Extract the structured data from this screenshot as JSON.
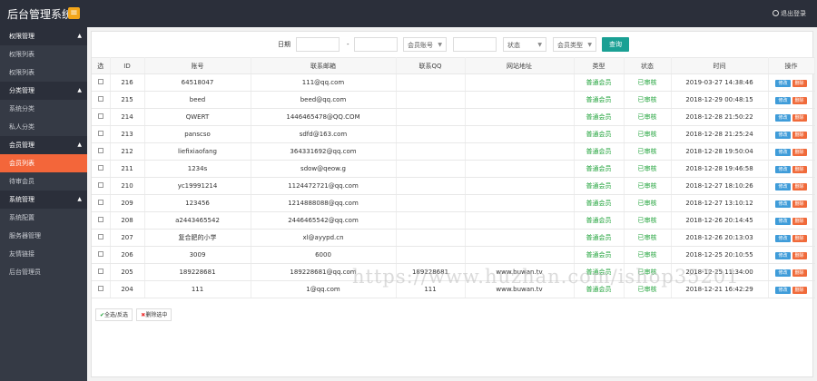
{
  "header": {
    "title": "后台管理系统",
    "menu_icon": "menu-icon",
    "logout": "退出登录"
  },
  "sidebar": {
    "groups": [
      {
        "label": "权限管理",
        "items": [
          "权限列表",
          "权限列表"
        ]
      },
      {
        "label": "分类管理",
        "items": [
          "系统分类",
          "私人分类"
        ]
      },
      {
        "label": "会员管理",
        "items": [
          "会员列表",
          "待审会员"
        ]
      },
      {
        "label": "系统管理",
        "items": [
          "系统配置",
          "服务器管理",
          "友情链接",
          "后台管理员"
        ]
      }
    ],
    "active": "会员列表"
  },
  "filter": {
    "date_label": "日期",
    "dash": "-",
    "account_select": "会员账号",
    "status_select": "状态",
    "type_select": "会员类型",
    "search_button": "查询"
  },
  "table": {
    "headers": [
      "选",
      "ID",
      "账号",
      "联系邮箱",
      "联系QQ",
      "网站地址",
      "类型",
      "状态",
      "时间",
      "操作"
    ],
    "rows": [
      [
        "216",
        "64518047",
        "111@qq.com",
        "",
        "",
        "普通会员",
        "已审核",
        "2019-03-27 14:38:46"
      ],
      [
        "215",
        "beed",
        "beed@qq.com",
        "",
        "",
        "普通会员",
        "已审核",
        "2018-12-29 00:48:15"
      ],
      [
        "214",
        "QWERT",
        "1446465478@QQ.COM",
        "",
        "",
        "普通会员",
        "已审核",
        "2018-12-28 21:50:22"
      ],
      [
        "213",
        "panscso",
        "sdfd@163.com",
        "",
        "",
        "普通会员",
        "已审核",
        "2018-12-28 21:25:24"
      ],
      [
        "212",
        "liefixiaofang",
        "364331692@qq.com",
        "",
        "",
        "普通会员",
        "已审核",
        "2018-12-28 19:50:04"
      ],
      [
        "211",
        "1234s",
        "sdow@qeow.g",
        "",
        "",
        "普通会员",
        "已审核",
        "2018-12-28 19:46:58"
      ],
      [
        "210",
        "yc19991214",
        "1124472721@qq.com",
        "",
        "",
        "普通会员",
        "已审核",
        "2018-12-27 18:10:26"
      ],
      [
        "209",
        "123456",
        "1214888088@qq.com",
        "",
        "",
        "普通会员",
        "已审核",
        "2018-12-27 13:10:12"
      ],
      [
        "208",
        "a2443465542",
        "2446465542@qq.com",
        "",
        "",
        "普通会员",
        "已审核",
        "2018-12-26 20:14:45"
      ],
      [
        "207",
        "复合肥的小学",
        "xl@ayypd.cn",
        "",
        "",
        "普通会员",
        "已审核",
        "2018-12-26 20:13:03"
      ],
      [
        "206",
        "3009",
        "6000",
        "",
        "",
        "普通会员",
        "已审核",
        "2018-12-25 20:10:55"
      ],
      [
        "205",
        "189228681",
        "189228681@qq.com",
        "189228681",
        "www.buwan.tv",
        "普通会员",
        "已审核",
        "2018-12-25 11:34:00"
      ],
      [
        "204",
        "111",
        "1@qq.com",
        "111",
        "www.buwan.tv",
        "普通会员",
        "已审核",
        "2018-12-21 16:42:29"
      ]
    ],
    "edit_label": "修改",
    "delete_label": "删除"
  },
  "bottom": {
    "select_all": "全选/反选",
    "delete_selected": "删除选中"
  },
  "watermark": "https://www.huzhan.com/ishop35201",
  "colors": {
    "topbar": "#2b2f3a",
    "sidebar": "#353a45",
    "active": "#f3663a",
    "search": "#1aa094",
    "status_green": "#21a33b"
  }
}
